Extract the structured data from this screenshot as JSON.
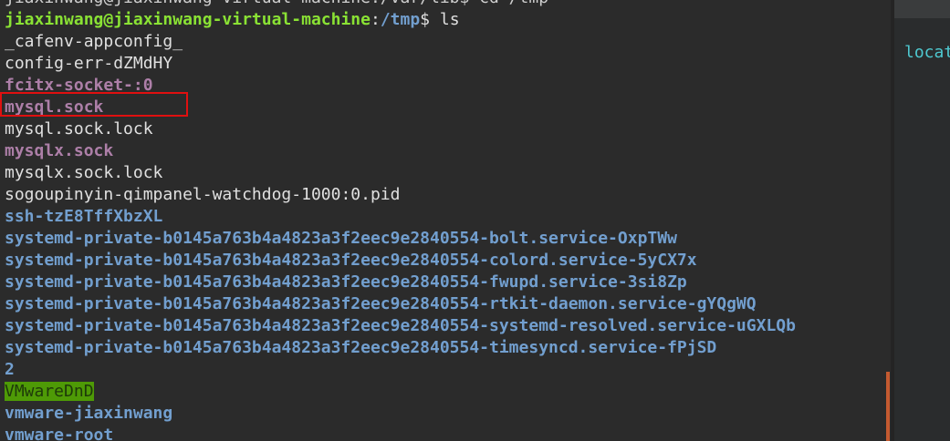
{
  "terminal": {
    "clipped_top_line": "jiaxinwang@jiaxinwang-virtual-machine:/var/lib$ cd /tmp",
    "prompt": {
      "user_host": "jiaxinwang@jiaxinwang-virtual-machine",
      "colon": ":",
      "path": "/tmp",
      "symbol": "$ ",
      "command": "ls"
    },
    "entries": [
      {
        "name": "_cafenv-appconfig_",
        "type": "plain"
      },
      {
        "name": "config-err-dZMdHY",
        "type": "plain"
      },
      {
        "name": "fcitx-socket-:0",
        "type": "socket"
      },
      {
        "name": "mysql.sock",
        "type": "socket",
        "highlighted": true
      },
      {
        "name": "mysql.sock.lock",
        "type": "plain"
      },
      {
        "name": "mysqlx.sock",
        "type": "socket"
      },
      {
        "name": "mysqlx.sock.lock",
        "type": "plain"
      },
      {
        "name": "sogoupinyin-qimpanel-watchdog-1000:0.pid",
        "type": "plain"
      },
      {
        "name": "ssh-tzE8TffXbzXL",
        "type": "dir"
      },
      {
        "name": "systemd-private-b0145a763b4a4823a3f2eec9e2840554-bolt.service-OxpTWw",
        "type": "dir"
      },
      {
        "name": "systemd-private-b0145a763b4a4823a3f2eec9e2840554-colord.service-5yCX7x",
        "type": "dir"
      },
      {
        "name": "systemd-private-b0145a763b4a4823a3f2eec9e2840554-fwupd.service-3si8Zp",
        "type": "dir"
      },
      {
        "name": "systemd-private-b0145a763b4a4823a3f2eec9e2840554-rtkit-daemon.service-gYQgWQ",
        "type": "dir"
      },
      {
        "name": "systemd-private-b0145a763b4a4823a3f2eec9e2840554-systemd-resolved.service-uGXLQb",
        "type": "dir"
      },
      {
        "name": "systemd-private-b0145a763b4a4823a3f2eec9e2840554-timesyncd.service-fPjSD",
        "type": "dir"
      },
      {
        "name": "2",
        "type": "dir"
      },
      {
        "name": "VMwareDnD",
        "type": "dir-hl"
      },
      {
        "name": "vmware-jiaxinwang",
        "type": "dir"
      },
      {
        "name": "vmware-root",
        "type": "dir"
      }
    ]
  },
  "side_panel": {
    "text": "locat"
  },
  "colors": {
    "terminal_bg": "#2b2b2b",
    "prompt_user": "#8ae234",
    "prompt_path": "#729fcf",
    "socket": "#ad7fa8",
    "directory": "#729fcf",
    "highlight_box": "#e01010",
    "side_text": "#4ec9d0"
  }
}
